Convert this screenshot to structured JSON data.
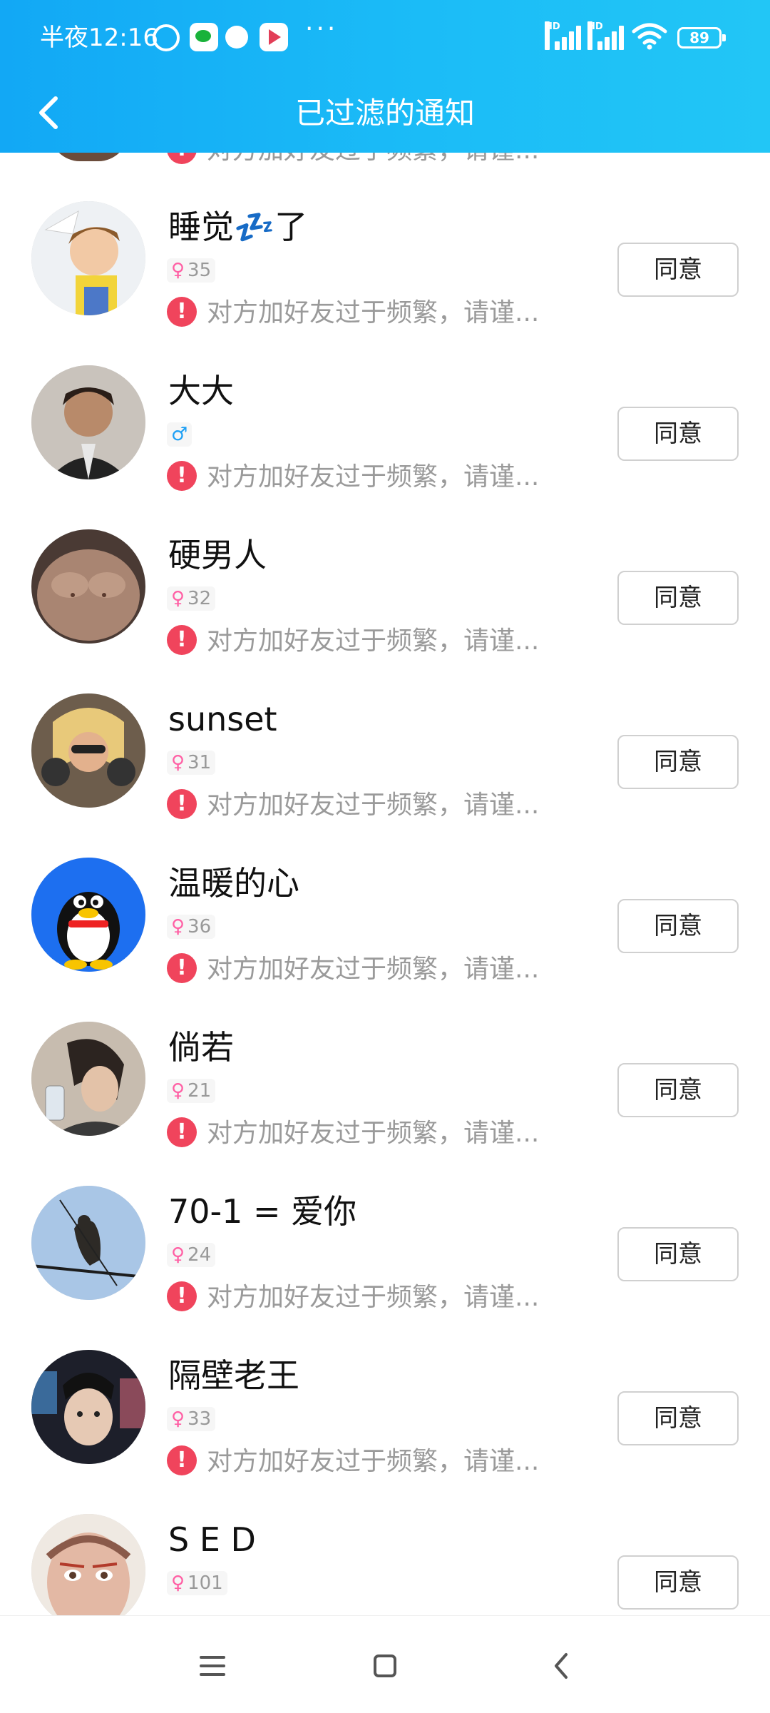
{
  "status_bar": {
    "time": "半夜12:16",
    "more": "···",
    "signal_1_label": "HD",
    "signal_2_label": "HD",
    "battery": "89",
    "icons": [
      "alarm-icon",
      "wechat-icon",
      "qq-icon",
      "play-store-icon",
      "more-icon",
      "signal-icon",
      "signal-icon",
      "wifi-icon",
      "battery-icon"
    ]
  },
  "header": {
    "title": "已过滤的通知",
    "back_icon": "back-arrow-icon"
  },
  "top_partial": {
    "warning": "对方加好友过于频繁，请谨..."
  },
  "items": [
    {
      "name": "睡觉💤了",
      "gender": "female",
      "age": "35",
      "warning": "对方加好友过于频繁，请谨...",
      "button": "同意"
    },
    {
      "name": "大大",
      "gender": "male",
      "age": "",
      "warning": "对方加好友过于频繁，请谨...",
      "button": "同意"
    },
    {
      "name": "硬男人",
      "gender": "female",
      "age": "32",
      "warning": "对方加好友过于频繁，请谨...",
      "button": "同意"
    },
    {
      "name": "sunset",
      "gender": "female",
      "age": "31",
      "warning": "对方加好友过于频繁，请谨...",
      "button": "同意"
    },
    {
      "name": "温暖的心",
      "gender": "female",
      "age": "36",
      "warning": "对方加好友过于频繁，请谨...",
      "button": "同意"
    },
    {
      "name": "倘若",
      "gender": "female",
      "age": "21",
      "warning": "对方加好友过于频繁，请谨...",
      "button": "同意"
    },
    {
      "name": "70-1 = 爱你",
      "gender": "female",
      "age": "24",
      "warning": "对方加好友过于频繁，请谨...",
      "button": "同意"
    },
    {
      "name": "隔壁老王",
      "gender": "female",
      "age": "33",
      "warning": "对方加好友过于频繁，请谨...",
      "button": "同意"
    },
    {
      "name": "S E D",
      "gender": "female",
      "age": "101",
      "warning": "",
      "button": "同意"
    }
  ],
  "gender_symbols": {
    "female": "♀",
    "male": "♂"
  },
  "bottom_nav": {
    "icons": [
      "menu-icon",
      "home-icon",
      "back-icon"
    ]
  },
  "colors": {
    "header_blue": "#12a8f5",
    "warning_red": "#f0445c",
    "female_pink": "#ff5fa4",
    "male_blue": "#1ea0f5"
  }
}
